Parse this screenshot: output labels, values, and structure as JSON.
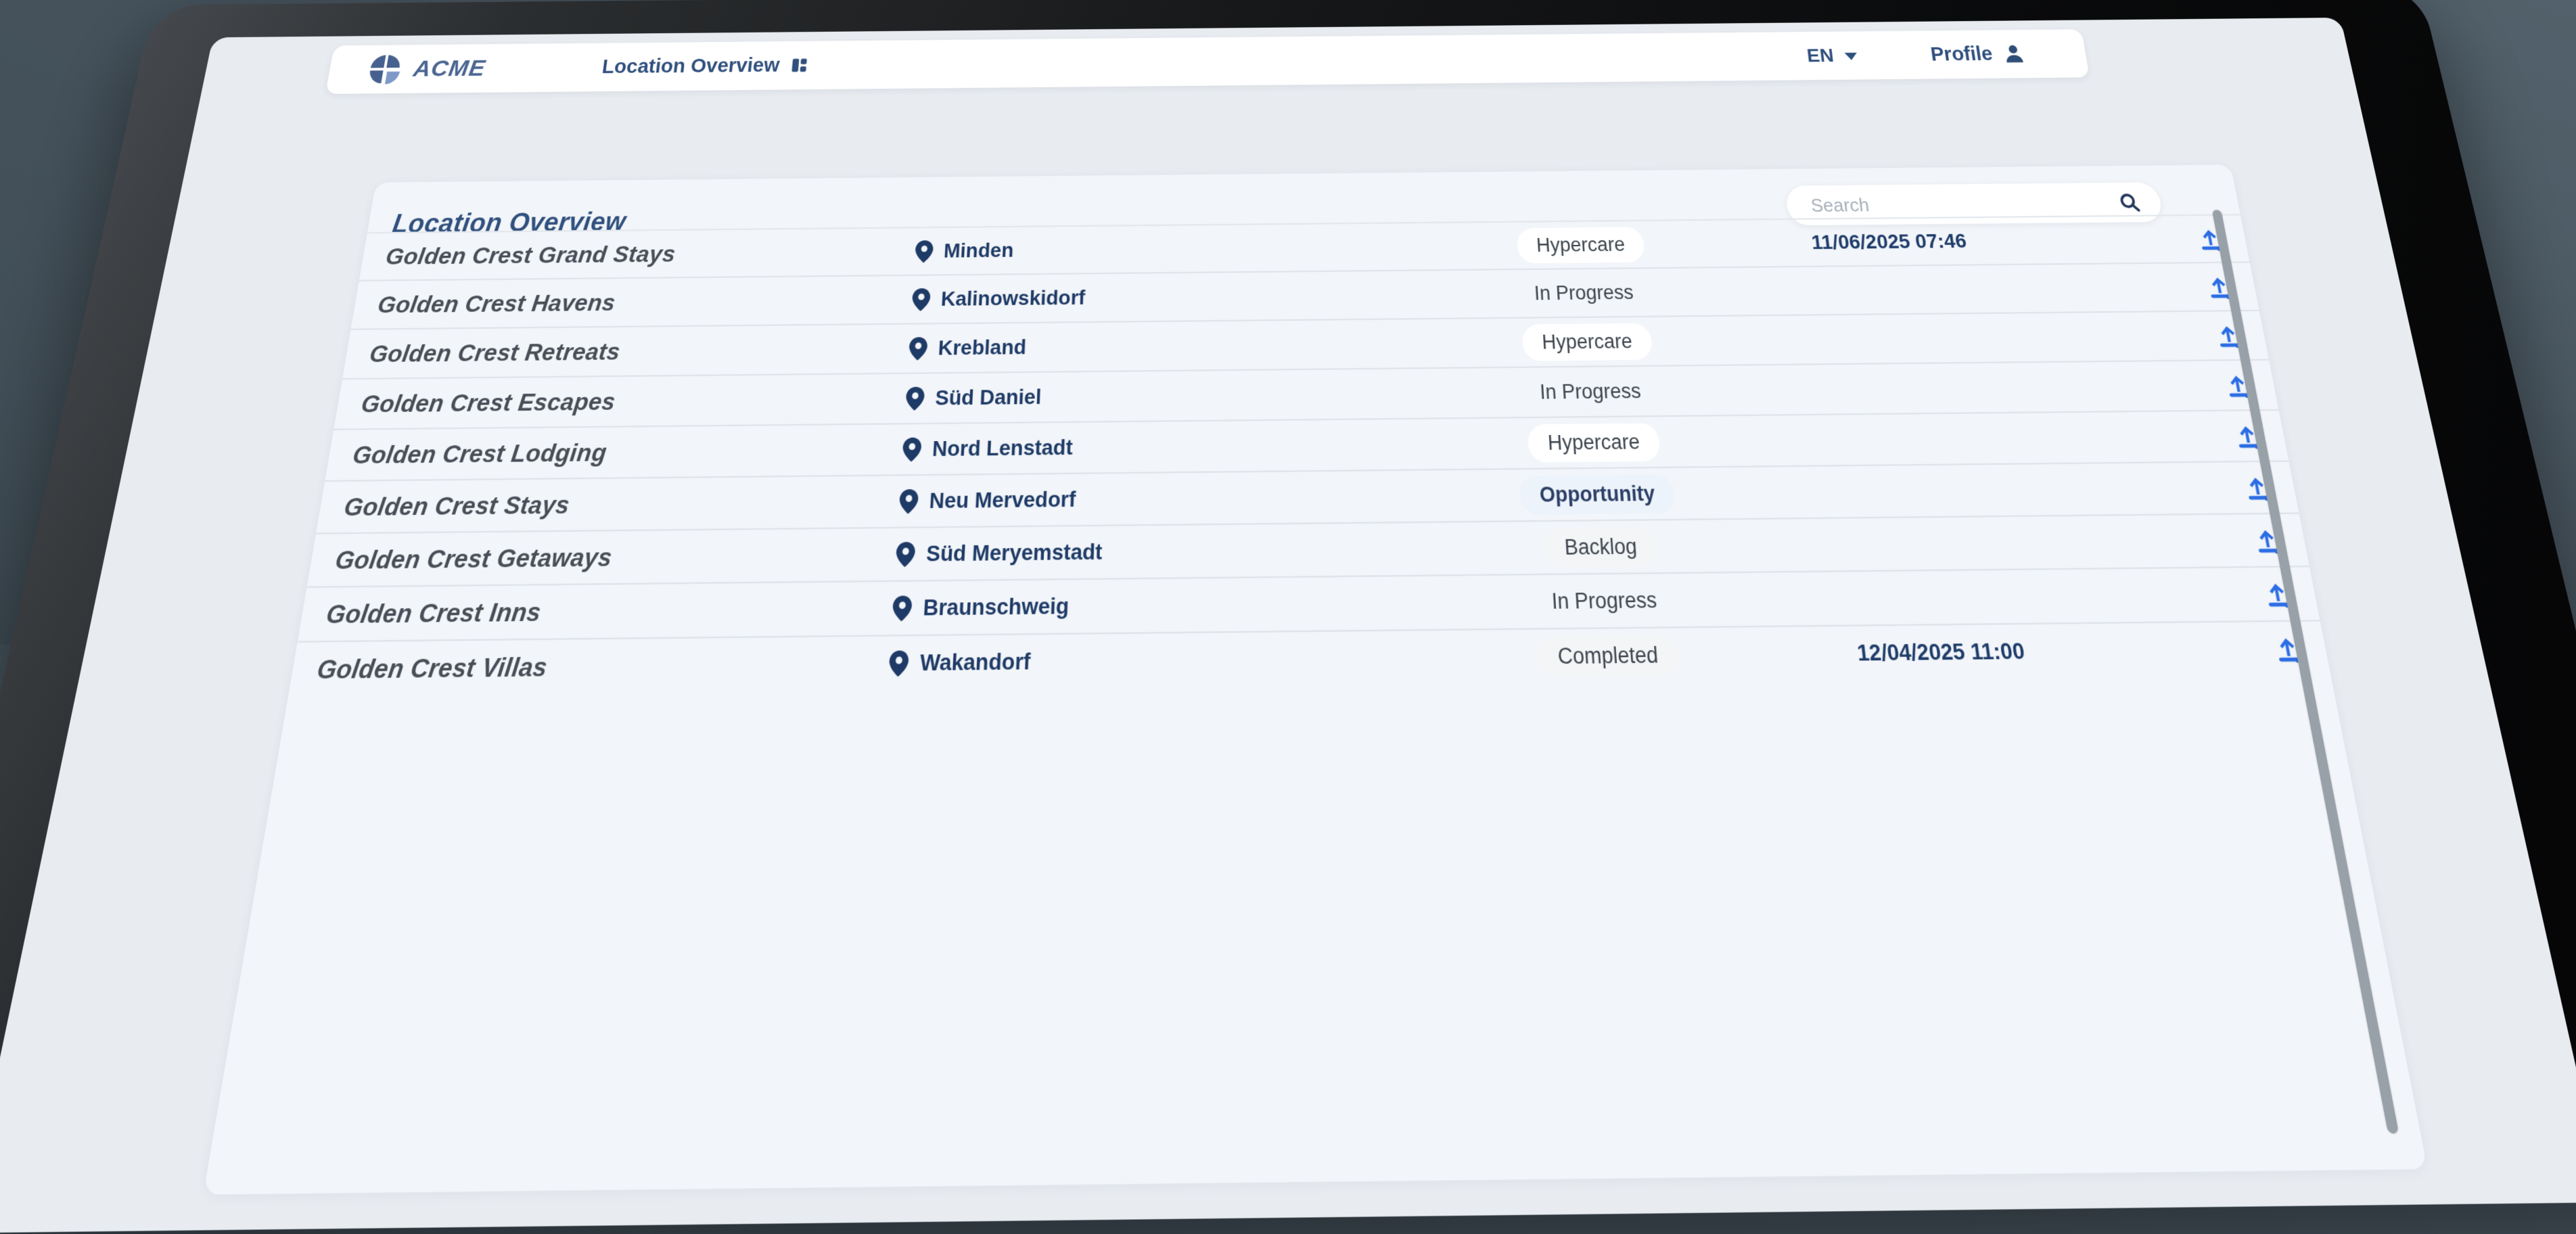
{
  "header": {
    "brand": "ACME",
    "nav_label": "Location Overview",
    "language": "EN",
    "profile": "Profile"
  },
  "main": {
    "title": "Location Overview",
    "search_placeholder": "Search"
  },
  "icons": {
    "logo": "quadrant-circle-logo-icon",
    "nav": "dashboard-grid-icon",
    "language": "chevron-down-icon",
    "profile": "person-icon",
    "search": "search-icon",
    "location": "map-pin-icon",
    "action": "upload-icon"
  },
  "colors": {
    "accent_navy": "#2f4f7d",
    "location_navy": "#1e3a66",
    "upload_blue": "#2c6de4",
    "page_bg": "#e8ecf1",
    "card_bg": "#f2f5f9",
    "background_slate": "#47545e",
    "bezel_black": "#0a0b0c"
  },
  "statuses": {
    "hypercare": {
      "label": "Hypercare",
      "bg": "#ffffff",
      "color": "#3d444d",
      "bold": false
    },
    "in_progress": {
      "label": "In Progress",
      "bg": "transparent",
      "color": "#3d444d",
      "bold": false
    },
    "opportunity": {
      "label": "Opportunity",
      "bg": "#edf3fa",
      "color": "#2b3e66",
      "bold": true
    },
    "backlog": {
      "label": "Backlog",
      "bg": "#f3f5f7",
      "color": "#3d444d",
      "bold": false
    },
    "completed": {
      "label": "Completed",
      "bg": "#f4f5f7",
      "color": "#3d444d",
      "bold": false
    }
  },
  "table": {
    "rows": [
      {
        "name": "Golden Crest Grand Stays",
        "location": "Minden",
        "status_key": "hypercare",
        "status": "Hypercare",
        "date": "11/06/2025 07:46"
      },
      {
        "name": "Golden Crest Havens",
        "location": "Kalinowskidorf",
        "status_key": "in_progress",
        "status": "In Progress",
        "date": ""
      },
      {
        "name": "Golden Crest Retreats",
        "location": "Krebland",
        "status_key": "hypercare",
        "status": "Hypercare",
        "date": ""
      },
      {
        "name": "Golden Crest Escapes",
        "location": "Süd Daniel",
        "status_key": "in_progress",
        "status": "In Progress",
        "date": ""
      },
      {
        "name": "Golden Crest Lodging",
        "location": "Nord Lenstadt",
        "status_key": "hypercare",
        "status": "Hypercare",
        "date": ""
      },
      {
        "name": "Golden Crest Stays",
        "location": "Neu Mervedorf",
        "status_key": "opportunity",
        "status": "Opportunity",
        "date": ""
      },
      {
        "name": "Golden Crest Getaways",
        "location": "Süd Meryemstadt",
        "status_key": "backlog",
        "status": "Backlog",
        "date": ""
      },
      {
        "name": "Golden Crest Inns",
        "location": "Braunschweig",
        "status_key": "in_progress",
        "status": "In Progress",
        "date": ""
      },
      {
        "name": "Golden Crest Villas",
        "location": "Wakandorf",
        "status_key": "completed",
        "status": "Completed",
        "date": "12/04/2025 11:00"
      }
    ]
  }
}
